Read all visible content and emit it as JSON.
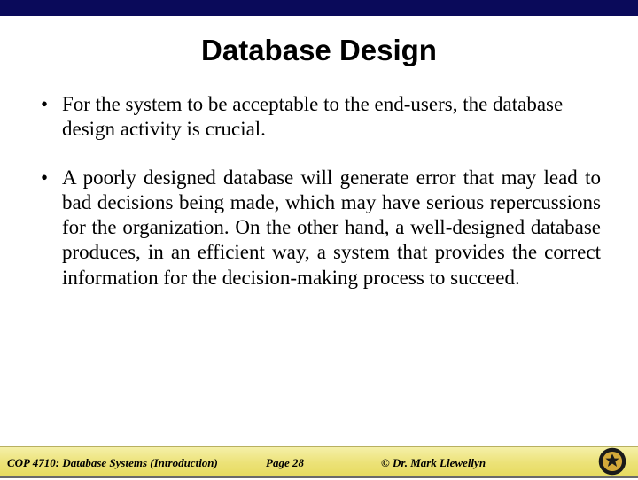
{
  "title": "Database Design",
  "bullets": [
    "For the system to be acceptable to the end-users, the database design activity is crucial.",
    "A poorly designed database will generate error that may lead to bad decisions being made, which may have serious repercussions for the organization. On the other hand, a well-designed database produces, in an efficient way, a system that provides the correct information for the decision-making process to succeed."
  ],
  "footer": {
    "course": "COP 4710: Database Systems  (Introduction)",
    "page": "Page 28",
    "copyright": "©  Dr. Mark Llewellyn"
  }
}
